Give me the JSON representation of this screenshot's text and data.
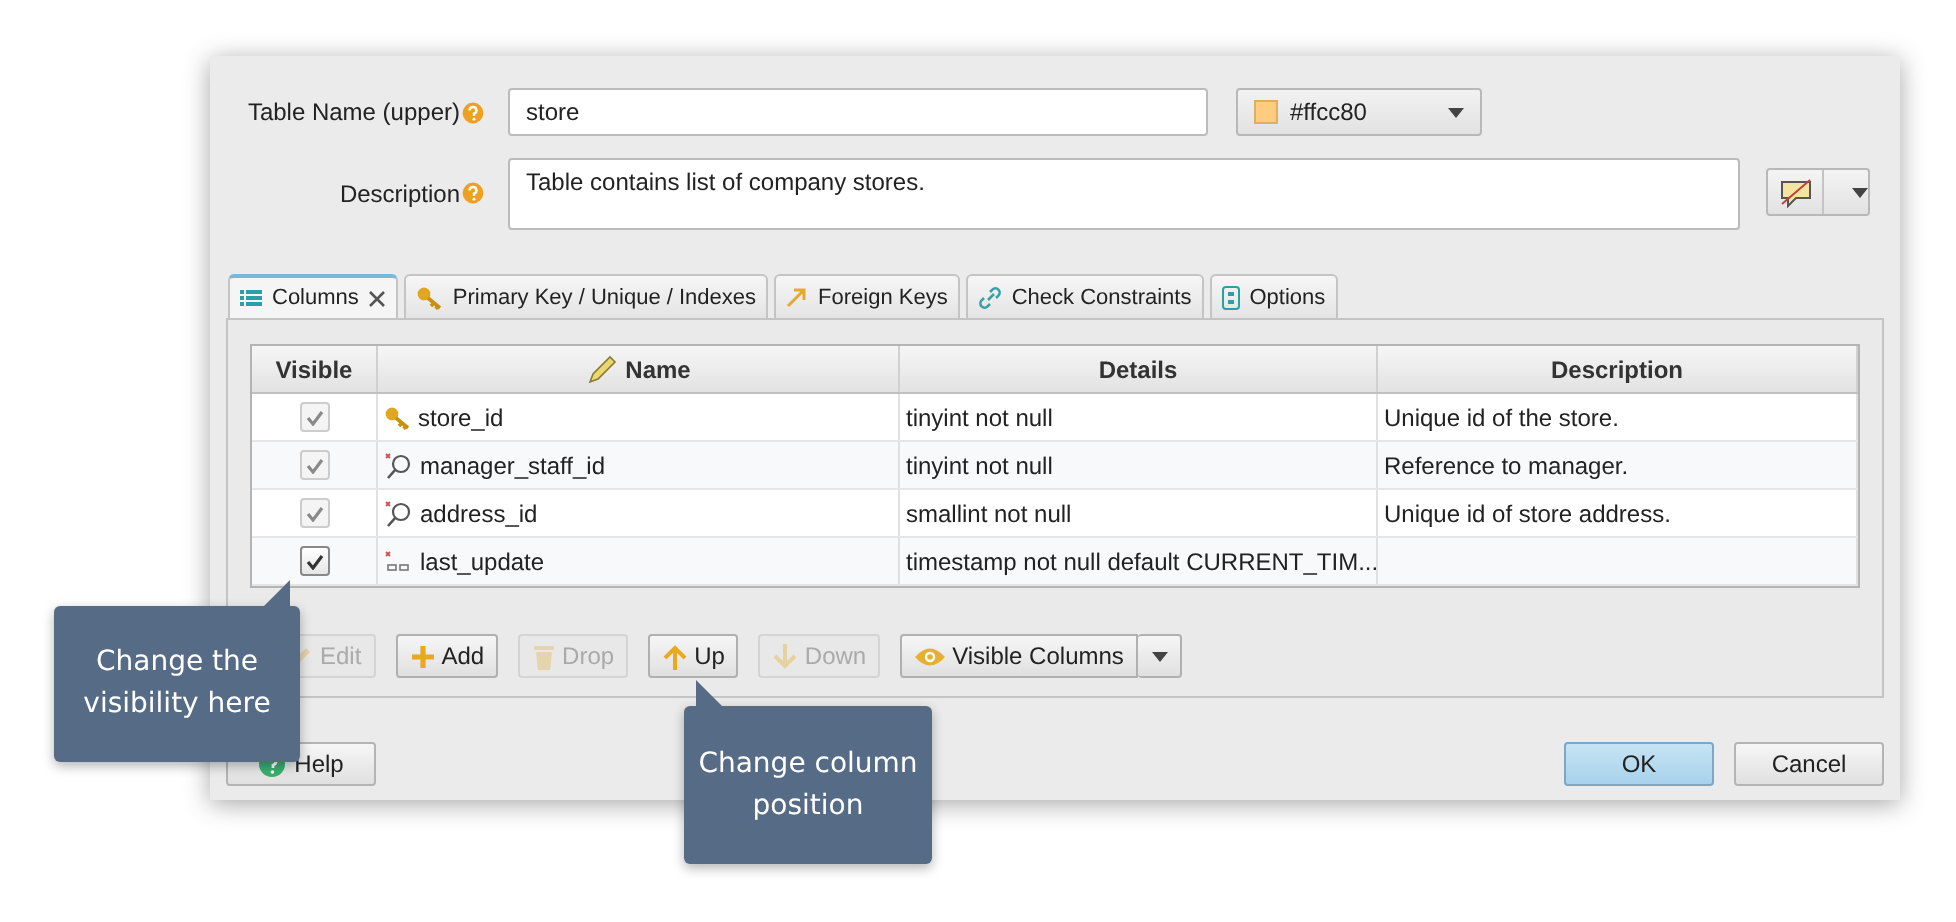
{
  "table_name": {
    "label": "Table Name (upper)",
    "value": "store"
  },
  "color_picker": {
    "value": "#ffcc80",
    "color": "#ffcc80"
  },
  "description": {
    "label": "Description",
    "value": "Table contains list of company stores."
  },
  "tabs": [
    {
      "label": "Columns",
      "selected": true,
      "closable": true,
      "kind": "columns"
    },
    {
      "label": "Primary Key / Unique / Indexes",
      "selected": false,
      "closable": false,
      "kind": "key"
    },
    {
      "label": "Foreign Keys",
      "selected": false,
      "closable": false,
      "kind": "arrow"
    },
    {
      "label": "Check Constraints",
      "selected": false,
      "closable": false,
      "kind": "link"
    },
    {
      "label": "Options",
      "selected": false,
      "closable": false,
      "kind": "options"
    }
  ],
  "table": {
    "columns": [
      "Visible",
      "Name",
      "Details",
      "Description"
    ],
    "rows": [
      {
        "visible": true,
        "disabled": true,
        "kind": "primary_key",
        "name": "store_id",
        "details": "tinyint not null",
        "description": "Unique id of the store."
      },
      {
        "visible": true,
        "disabled": true,
        "kind": "foreign_key",
        "name": "manager_staff_id",
        "details": "tinyint not null",
        "description": "Reference to manager."
      },
      {
        "visible": true,
        "disabled": true,
        "kind": "foreign_key",
        "name": "address_id",
        "details": "smallint not null",
        "description": "Unique id of store address."
      },
      {
        "visible": true,
        "disabled": false,
        "kind": "column",
        "name": "last_update",
        "details": "timestamp not null default CURRENT_TIM...",
        "description": ""
      }
    ]
  },
  "toolbar": [
    {
      "label": "Edit",
      "kind": "edit",
      "disabled": true
    },
    {
      "label": "Add",
      "kind": "add",
      "disabled": false
    },
    {
      "label": "Drop",
      "kind": "drop",
      "disabled": true
    },
    {
      "label": "Up",
      "kind": "up",
      "disabled": false
    },
    {
      "label": "Down",
      "kind": "down",
      "disabled": true
    },
    {
      "label": "Visible Columns",
      "kind": "eye",
      "disabled": false
    }
  ],
  "footer": {
    "help": "Help",
    "ok": "OK",
    "cancel": "Cancel"
  },
  "callouts": [
    {
      "text": "Change the visibility here",
      "kind": "left"
    },
    {
      "text": "Change column position",
      "kind": "below"
    }
  ]
}
